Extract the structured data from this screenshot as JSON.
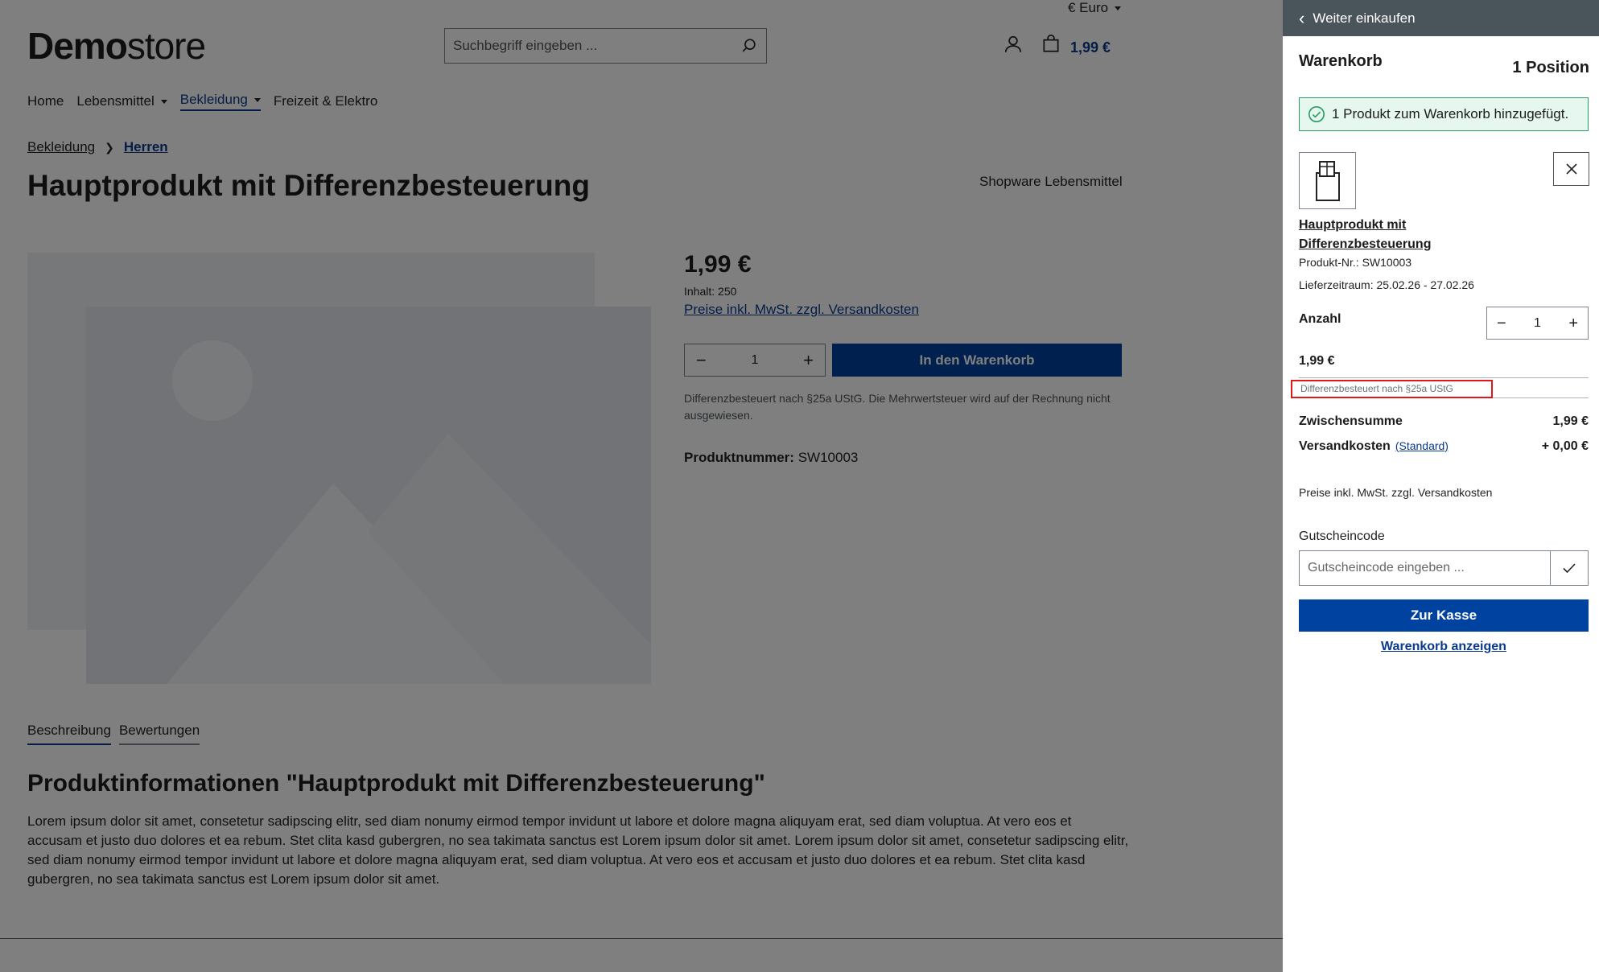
{
  "header": {
    "currency_label": "€ Euro",
    "logo_bold": "Demo",
    "logo_light": "store",
    "search_placeholder": "Suchbegriff eingeben ...",
    "cart_total": "1,99 €"
  },
  "nav": {
    "items": [
      {
        "label": "Home"
      },
      {
        "label": "Lebensmittel"
      },
      {
        "label": "Bekleidung"
      },
      {
        "label": "Freizeit & Elektro"
      }
    ]
  },
  "breadcrumb": {
    "items": [
      "Bekleidung",
      "Herren"
    ]
  },
  "product": {
    "title": "Hauptprodukt mit Differenzbesteuerung",
    "manufacturer": "Shopware Lebensmittel",
    "price": "1,99 €",
    "content": "Inhalt: 250",
    "tax_link": "Preise inkl. MwSt. zzgl. Versandkosten",
    "quantity": "1",
    "add_to_cart": "In den Warenkorb",
    "diff_note": "Differenzbesteuert nach §25a UStG. Die Mehrwertsteuer wird auf der Rechnung nicht ausgewiesen.",
    "number_label": "Produktnummer:",
    "number_value": "SW10003"
  },
  "tabs": [
    {
      "label": "Beschreibung"
    },
    {
      "label": "Bewertungen"
    }
  ],
  "description": {
    "title": "Produktinformationen \"Hauptprodukt mit Differenzbesteuerung\"",
    "text": "Lorem ipsum dolor sit amet, consetetur sadipscing elitr, sed diam nonumy eirmod tempor invidunt ut labore et dolore magna aliquyam erat, sed diam voluptua. At vero eos et accusam et justo duo dolores et ea rebum. Stet clita kasd gubergren, no sea takimata sanctus est Lorem ipsum dolor sit amet. Lorem ipsum dolor sit amet, consetetur sadipscing elitr, sed diam nonumy eirmod tempor invidunt ut labore et dolore magna aliquyam erat, sed diam voluptua. At vero eos et accusam et justo duo dolores et ea rebum. Stet clita kasd gubergren, no sea takimata sanctus est Lorem ipsum dolor sit amet."
  },
  "cart": {
    "back_label": "Weiter einkaufen",
    "title": "Warenkorb",
    "count": "1 Position",
    "success": "1 Produkt zum Warenkorb hinzugefügt.",
    "item_name": "Hauptprodukt mit Differenzbesteuerung",
    "item_number": "Produkt-Nr.: SW10003",
    "item_delivery": "Lieferzeitraum: 25.02.26 - 27.02.26",
    "qty_label": "Anzahl",
    "qty_value": "1",
    "item_price": "1,99 €",
    "diff_note": "Differenzbesteuert nach §25a UStG",
    "subtotal_label": "Zwischensumme",
    "subtotal_value": "1,99 €",
    "shipping_label": "Versandkosten",
    "shipping_method": "(Standard)",
    "shipping_value": "+ 0,00 €",
    "vat_note": "Preise inkl. MwSt. zzgl. Versandkosten",
    "voucher_label": "Gutscheincode",
    "voucher_placeholder": "Gutscheincode eingeben ...",
    "checkout": "Zur Kasse",
    "view_cart": "Warenkorb anzeigen"
  },
  "colors": {
    "brand_primary": "#0042a0",
    "link": "#0b3a8c",
    "success_bg": "#e6f7ef",
    "success_border": "#2a9d63",
    "highlight": "#e21818"
  }
}
